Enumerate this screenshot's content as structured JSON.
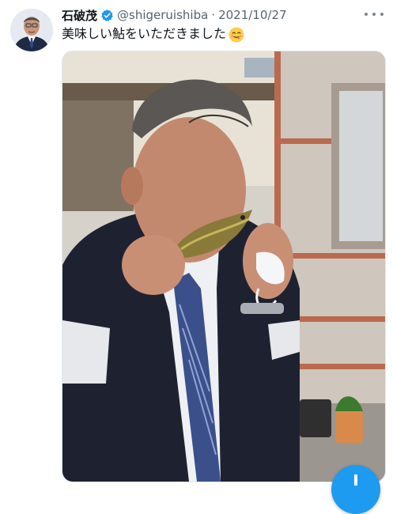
{
  "tweet": {
    "author_name": "石破茂",
    "handle": "@shigeruishiba",
    "separator": "·",
    "date": "2021/10/27",
    "text": "美味しい鮎をいただきました",
    "verified": true,
    "emoji": "smiling-face-icon"
  },
  "icons": {
    "verified": "verified-badge-icon",
    "more": "more-options-icon",
    "compose": "compose-plus-icon"
  },
  "colors": {
    "accent": "#1d9bf0",
    "secondary_text": "#536471",
    "primary_text": "#0f1419"
  }
}
